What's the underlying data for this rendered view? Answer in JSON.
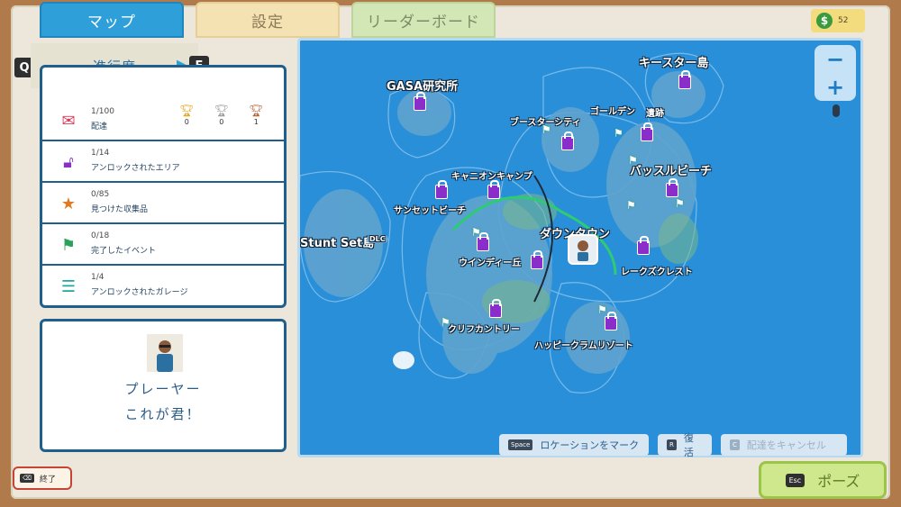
{
  "tabs": {
    "map": "マップ",
    "settings": "設定",
    "leaderboard": "リーダーボード"
  },
  "money": {
    "icon": "dollar-coin-icon",
    "value": "52"
  },
  "progress": {
    "key_left": "Q",
    "key_right": "E",
    "title": "進行度",
    "stats": [
      {
        "icon": "delivery-icon",
        "count": "1/100",
        "label": "配達"
      },
      {
        "icon": "unlock-icon",
        "count": "1/14",
        "label": "アンロックされたエリア"
      },
      {
        "icon": "collectible-icon",
        "count": "0/85",
        "label": "見つけた収集品"
      },
      {
        "icon": "flag-icon",
        "count": "0/18",
        "label": "完了したイベント"
      },
      {
        "icon": "garage-icon",
        "count": "1/4",
        "label": "アンロックされたガレージ"
      }
    ],
    "trophies": [
      {
        "icon": "gold-trophy-icon",
        "value": "0"
      },
      {
        "icon": "silver-trophy-icon",
        "value": "0"
      },
      {
        "icon": "bronze-trophy-icon",
        "value": "1"
      }
    ]
  },
  "player": {
    "name": "プレーヤー",
    "subtitle": "これが君！"
  },
  "quit": {
    "key": "⌫",
    "label": "終了"
  },
  "map": {
    "labels": {
      "gasa": "GASA研究所",
      "easter": "キースター島",
      "booster": "ブースターシティ",
      "golden": "ゴールデン",
      "ruins": "遺跡",
      "canyon": "キャニオンキャンプ",
      "sunset": "サンセットビーチ",
      "town": "ダウンタウン",
      "stunt": "Stunt Set島",
      "dlc": "DLC",
      "windy": "ウインディー丘",
      "battle_beach": "バッスルビーチ",
      "lakes": "レークズクレスト",
      "cliff": "クリフカントリー",
      "happy": "ハッピークラムリゾート"
    },
    "zoom_out": "−",
    "zoom_in": "+"
  },
  "footer": {
    "mark_key": "Space",
    "mark_label": "ロケーションをマーク",
    "respawn_key": "R",
    "respawn_label": "復活",
    "cancel_key": "C",
    "cancel_label": "配達をキャンセル",
    "pause_key": "Esc",
    "pause_label": "ポーズ"
  }
}
